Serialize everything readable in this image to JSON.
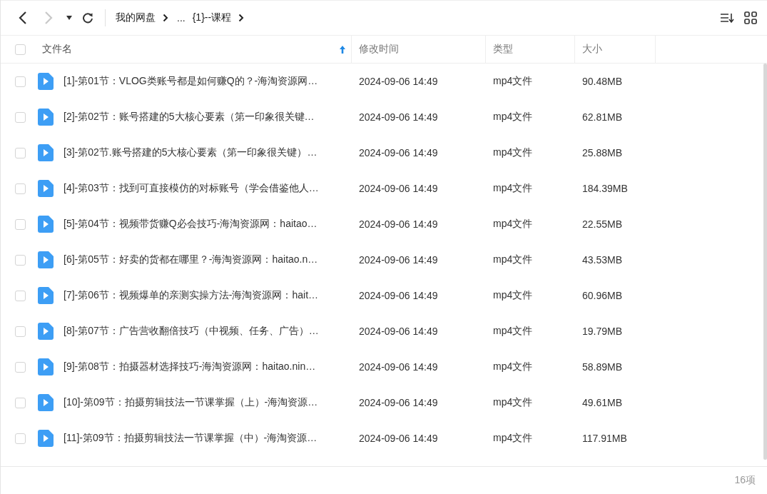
{
  "toolbar": {
    "back_disabled": false,
    "forward_disabled": true,
    "breadcrumbs": [
      "我的网盘",
      "...",
      "{1}--课程"
    ]
  },
  "table": {
    "all_checked": false,
    "columns": [
      {
        "label": "文件名",
        "sorted": true
      },
      {
        "label": "修改时间",
        "sorted": false
      },
      {
        "label": "类型",
        "sorted": false
      },
      {
        "label": "大小",
        "sorted": false
      }
    ],
    "rows": [
      {
        "name": "[1]-第01节：VLOG类账号都是如何赚Q的？-海淘资源网…",
        "modified": "2024-09-06 14:49",
        "type": "mp4文件",
        "size": "90.48MB",
        "checked": false
      },
      {
        "name": "[2]-第02节：账号搭建的5大核心要素（第一印象很关键…",
        "modified": "2024-09-06 14:49",
        "type": "mp4文件",
        "size": "62.81MB",
        "checked": false
      },
      {
        "name": "[3]-第02节.账号搭建的5大核心要素（第一印象很关键）…",
        "modified": "2024-09-06 14:49",
        "type": "mp4文件",
        "size": "25.88MB",
        "checked": false
      },
      {
        "name": "[4]-第03节：找到可直接模仿的对标账号（学会借鉴他人…",
        "modified": "2024-09-06 14:49",
        "type": "mp4文件",
        "size": "184.39MB",
        "checked": false
      },
      {
        "name": "[5]-第04节：视频带货赚Q必会技巧-海淘资源网：haitao…",
        "modified": "2024-09-06 14:49",
        "type": "mp4文件",
        "size": "22.55MB",
        "checked": false
      },
      {
        "name": "[6]-第05节：好卖的货都在哪里？-海淘资源网：haitao.n…",
        "modified": "2024-09-06 14:49",
        "type": "mp4文件",
        "size": "43.53MB",
        "checked": false
      },
      {
        "name": "[7]-第06节：视频爆单的亲测实操方法-海淘资源网：hait…",
        "modified": "2024-09-06 14:49",
        "type": "mp4文件",
        "size": "60.96MB",
        "checked": false
      },
      {
        "name": "[8]-第07节：广告营收翻倍技巧（中视频、任务、广告）…",
        "modified": "2024-09-06 14:49",
        "type": "mp4文件",
        "size": "19.79MB",
        "checked": false
      },
      {
        "name": "[9]-第08节：拍摄器材选择技巧-海淘资源网：haitao.nin…",
        "modified": "2024-09-06 14:49",
        "type": "mp4文件",
        "size": "58.89MB",
        "checked": false
      },
      {
        "name": "[10]-第09节：拍摄剪辑技法一节课掌握（上）-海淘资源…",
        "modified": "2024-09-06 14:49",
        "type": "mp4文件",
        "size": "49.61MB",
        "checked": false
      },
      {
        "name": "[11]-第09节：拍摄剪辑技法一节课掌握（中）-海淘资源…",
        "modified": "2024-09-06 14:49",
        "type": "mp4文件",
        "size": "117.91MB",
        "checked": false
      }
    ]
  },
  "status_bar": {
    "count": "16项"
  }
}
